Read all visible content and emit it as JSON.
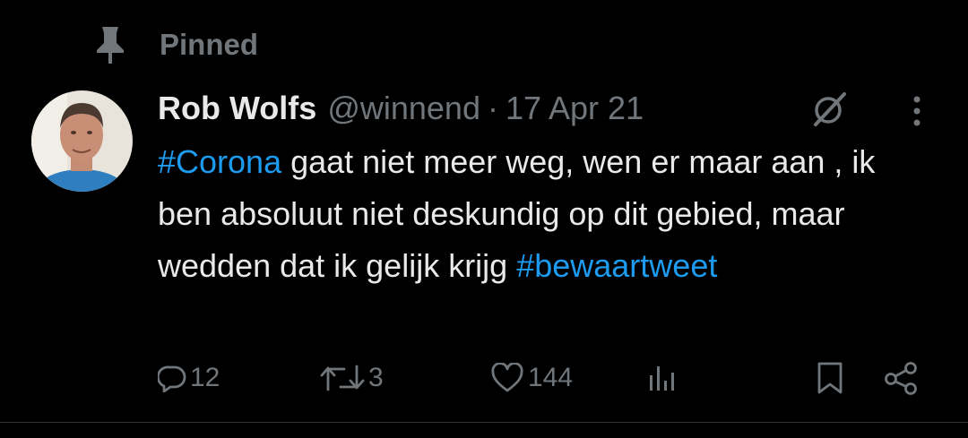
{
  "pinned": {
    "label": "Pinned"
  },
  "tweet": {
    "author_name": "Rob Wolfs",
    "handle": "@winnend",
    "separator": "·",
    "date": "17 Apr 21",
    "text_segments": [
      {
        "text": "#Corona",
        "type": "hashtag"
      },
      {
        "text": " gaat niet meer weg, wen er maar aan , ik ben absoluut niet deskundig op dit gebied, maar wedden dat ik gelijk krijg ",
        "type": "text"
      },
      {
        "text": "#bewaartweet",
        "type": "hashtag"
      }
    ]
  },
  "actions": {
    "replies": "12",
    "retweets": "3",
    "likes": "144"
  },
  "icons": {
    "pin": "pin-icon",
    "grok": "grok-icon",
    "more": "more-vertical-icon",
    "reply": "reply-icon",
    "retweet": "retweet-icon",
    "like": "heart-icon",
    "views": "views-icon",
    "bookmark": "bookmark-icon",
    "share": "share-icon"
  },
  "colors": {
    "background": "#000000",
    "text": "#e7e9ea",
    "secondary": "#71767b",
    "hashtag": "#1d9bf0"
  }
}
